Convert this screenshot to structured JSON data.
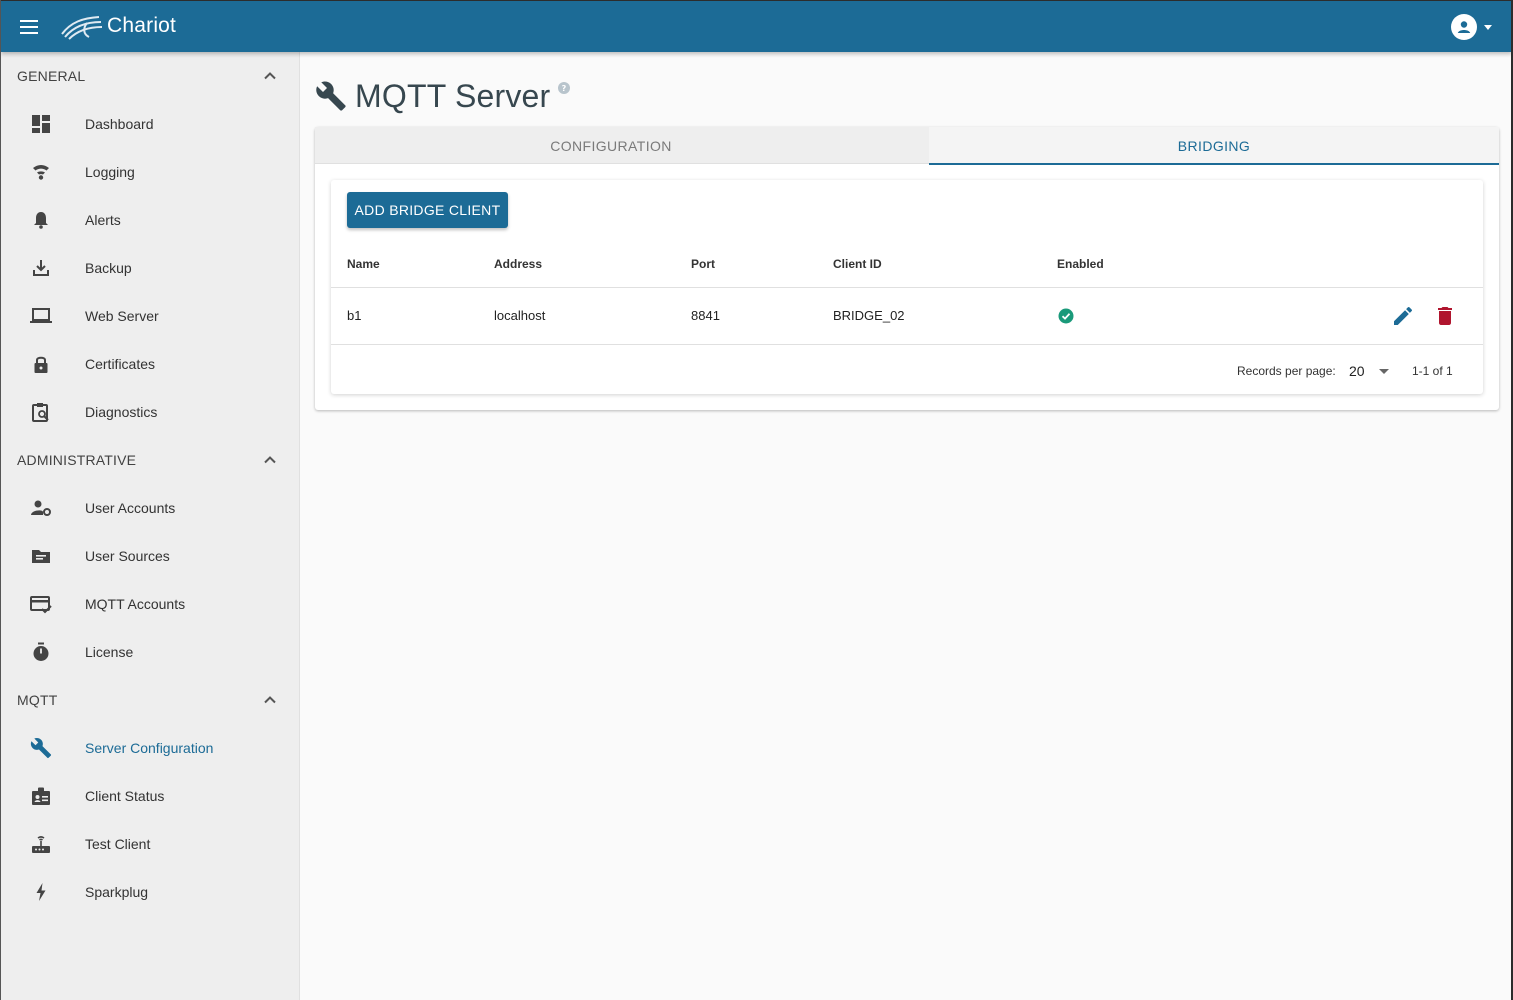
{
  "app": {
    "brand": "Chariot",
    "colors": {
      "primary": "#1c6b96",
      "success": "#1a9a7a",
      "danger": "#b0152e"
    }
  },
  "sidebar": {
    "sections": [
      {
        "label": "GENERAL",
        "items": [
          {
            "label": "Dashboard",
            "icon": "dashboard-icon"
          },
          {
            "label": "Logging",
            "icon": "logging-icon"
          },
          {
            "label": "Alerts",
            "icon": "bell-icon"
          },
          {
            "label": "Backup",
            "icon": "download-icon"
          },
          {
            "label": "Web Server",
            "icon": "laptop-icon"
          },
          {
            "label": "Certificates",
            "icon": "lock-icon"
          },
          {
            "label": "Diagnostics",
            "icon": "clipboard-search-icon"
          }
        ]
      },
      {
        "label": "ADMINISTRATIVE",
        "items": [
          {
            "label": "User Accounts",
            "icon": "user-gear-icon"
          },
          {
            "label": "User Sources",
            "icon": "folder-icon"
          },
          {
            "label": "MQTT Accounts",
            "icon": "card-check-icon"
          },
          {
            "label": "License",
            "icon": "stopwatch-icon"
          }
        ]
      },
      {
        "label": "MQTT",
        "items": [
          {
            "label": "Server Configuration",
            "icon": "wrench-icon",
            "active": true
          },
          {
            "label": "Client Status",
            "icon": "badge-icon"
          },
          {
            "label": "Test Client",
            "icon": "router-icon"
          },
          {
            "label": "Sparkplug",
            "icon": "lightning-icon"
          }
        ]
      }
    ]
  },
  "page": {
    "title": "MQTT Server",
    "tabs": [
      {
        "label": "CONFIGURATION",
        "active": false
      },
      {
        "label": "BRIDGING",
        "active": true
      }
    ],
    "add_button_label": "ADD BRIDGE CLIENT",
    "table": {
      "columns": [
        "Name",
        "Address",
        "Port",
        "Client ID",
        "Enabled"
      ],
      "rows": [
        {
          "name": "b1",
          "address": "localhost",
          "port": "8841",
          "client_id": "BRIDGE_02",
          "enabled": true
        }
      ]
    },
    "pagination": {
      "records_per_page_label": "Records per page:",
      "records_per_page": "20",
      "range": "1-1 of 1"
    }
  }
}
